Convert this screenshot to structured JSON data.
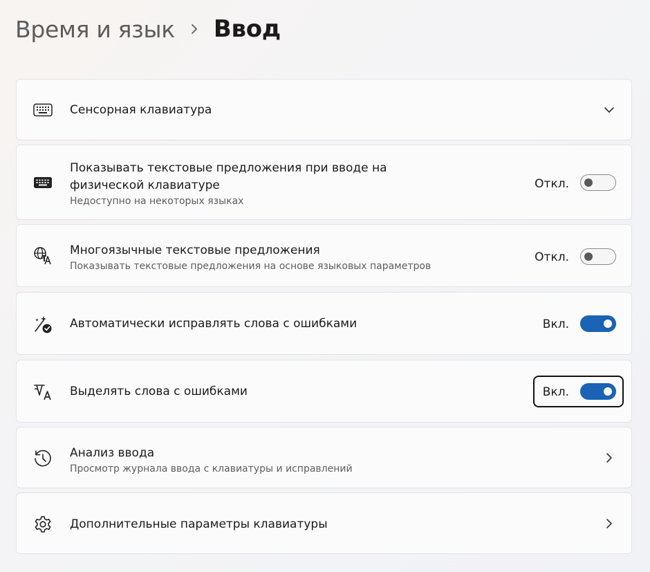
{
  "breadcrumb": {
    "parent": "Время и язык",
    "current": "Ввод"
  },
  "settings": [
    {
      "icon": "touch-keyboard-icon",
      "title": "Сенсорная клавиатура",
      "control": "expand"
    },
    {
      "icon": "keyboard-icon",
      "title": "Показывать текстовые предложения при вводе на физической клавиатуре",
      "subtitle": "Недоступно на некоторых языках",
      "control": "toggle",
      "state_label": "Откл.",
      "on": false
    },
    {
      "icon": "multilingual-icon",
      "title": "Многоязычные текстовые предложения",
      "subtitle": "Показывать текстовые предложения на основе языковых параметров",
      "control": "toggle",
      "state_label": "Откл.",
      "on": false
    },
    {
      "icon": "autocorrect-icon",
      "title": "Автоматически исправлять слова с ошибками",
      "control": "toggle",
      "state_label": "Вкл.",
      "on": true
    },
    {
      "icon": "spellcheck-icon",
      "title": "Выделять слова с ошибками",
      "control": "toggle",
      "state_label": "Вкл.",
      "on": true,
      "focused": true
    },
    {
      "icon": "history-icon",
      "title": "Анализ ввода",
      "subtitle": "Просмотр журнала ввода с клавиатуры и исправлений",
      "control": "navigate"
    },
    {
      "icon": "gear-icon",
      "title": "Дополнительные параметры клавиатуры",
      "control": "navigate"
    }
  ],
  "colors": {
    "accent": "#1a63b5",
    "card_background": "#fbfbfc",
    "card_border": "#e3e3e6",
    "text_primary": "#1b1b1b",
    "text_secondary": "#5d5d5d"
  }
}
